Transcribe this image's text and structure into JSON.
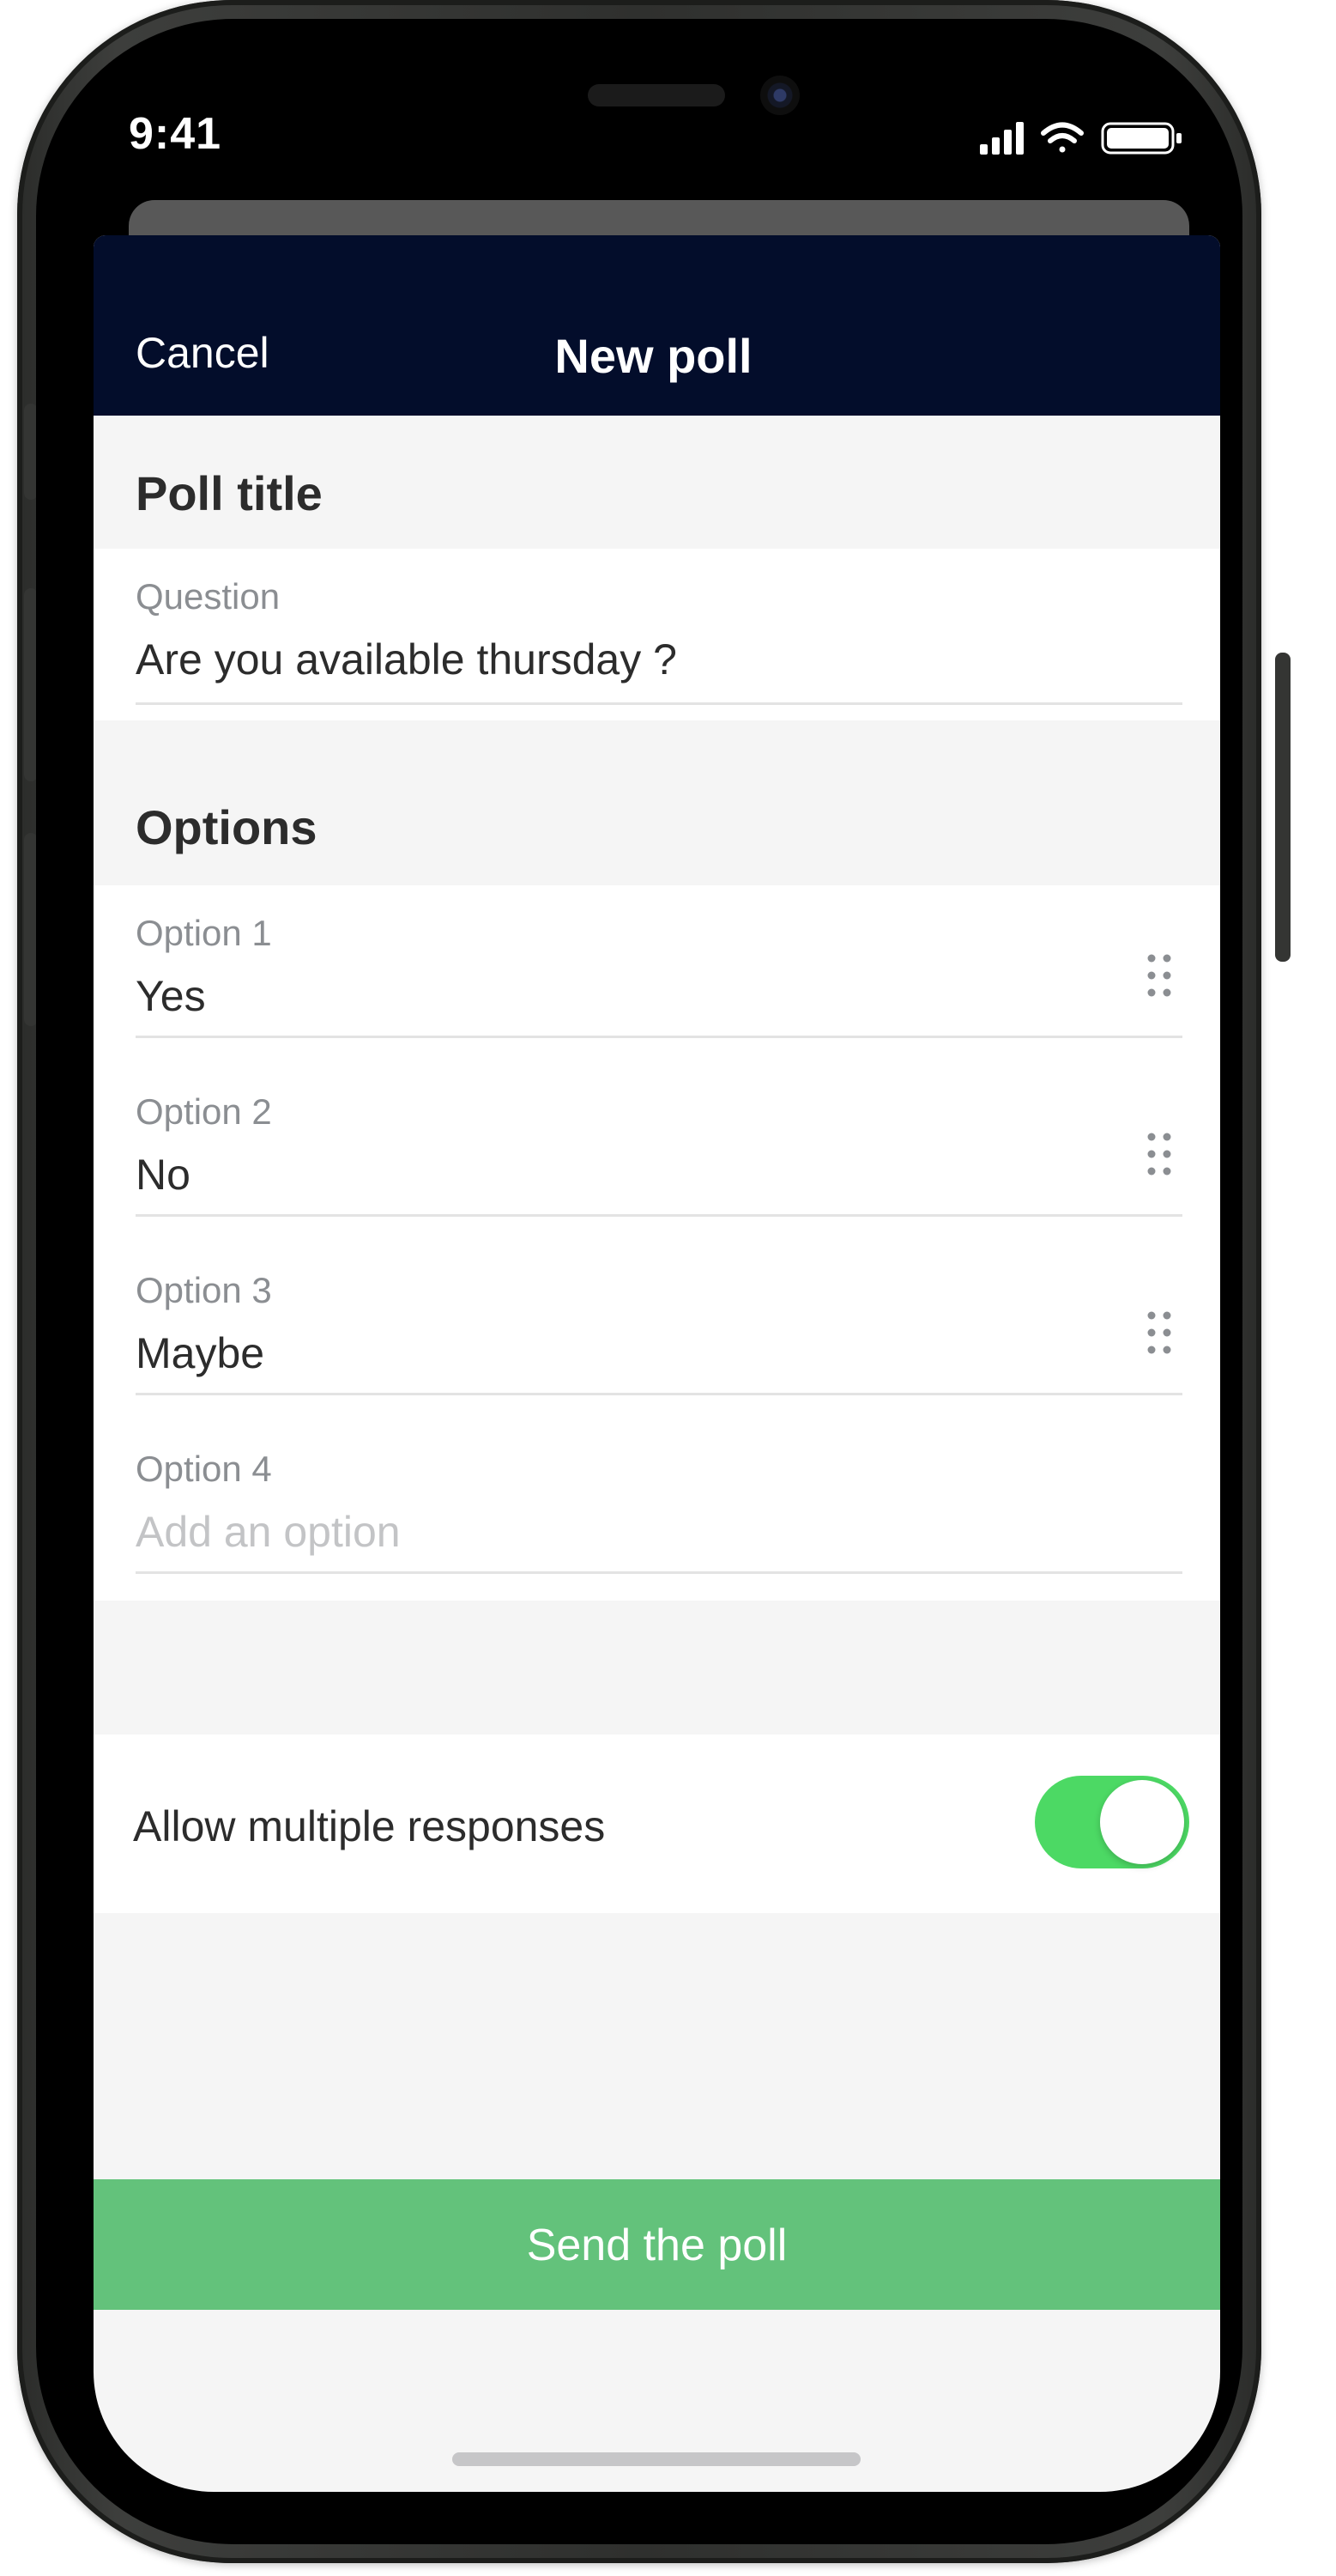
{
  "status_bar": {
    "time": "9:41",
    "icons": [
      "cellular-signal-icon",
      "wifi-icon",
      "battery-icon"
    ]
  },
  "nav": {
    "cancel_label": "Cancel",
    "title": "New poll"
  },
  "poll_title_section": {
    "heading": "Poll title",
    "question_label": "Question",
    "question_value": "Are you available thursday ?"
  },
  "options_section": {
    "heading": "Options",
    "options": [
      {
        "label": "Option 1",
        "value": "Yes",
        "placeholder": "",
        "draggable": true
      },
      {
        "label": "Option 2",
        "value": "No",
        "placeholder": "",
        "draggable": true
      },
      {
        "label": "Option 3",
        "value": "Maybe",
        "placeholder": "",
        "draggable": true
      },
      {
        "label": "Option 4",
        "value": "",
        "placeholder": "Add an option",
        "draggable": false
      }
    ]
  },
  "settings": {
    "allow_multiple_label": "Allow multiple responses",
    "allow_multiple_enabled": true
  },
  "send_button_label": "Send the poll",
  "colors": {
    "nav_background": "#030d2b",
    "toggle_on": "#4cd964",
    "send_button": "#63c27b",
    "page_background": "#f5f5f5"
  }
}
